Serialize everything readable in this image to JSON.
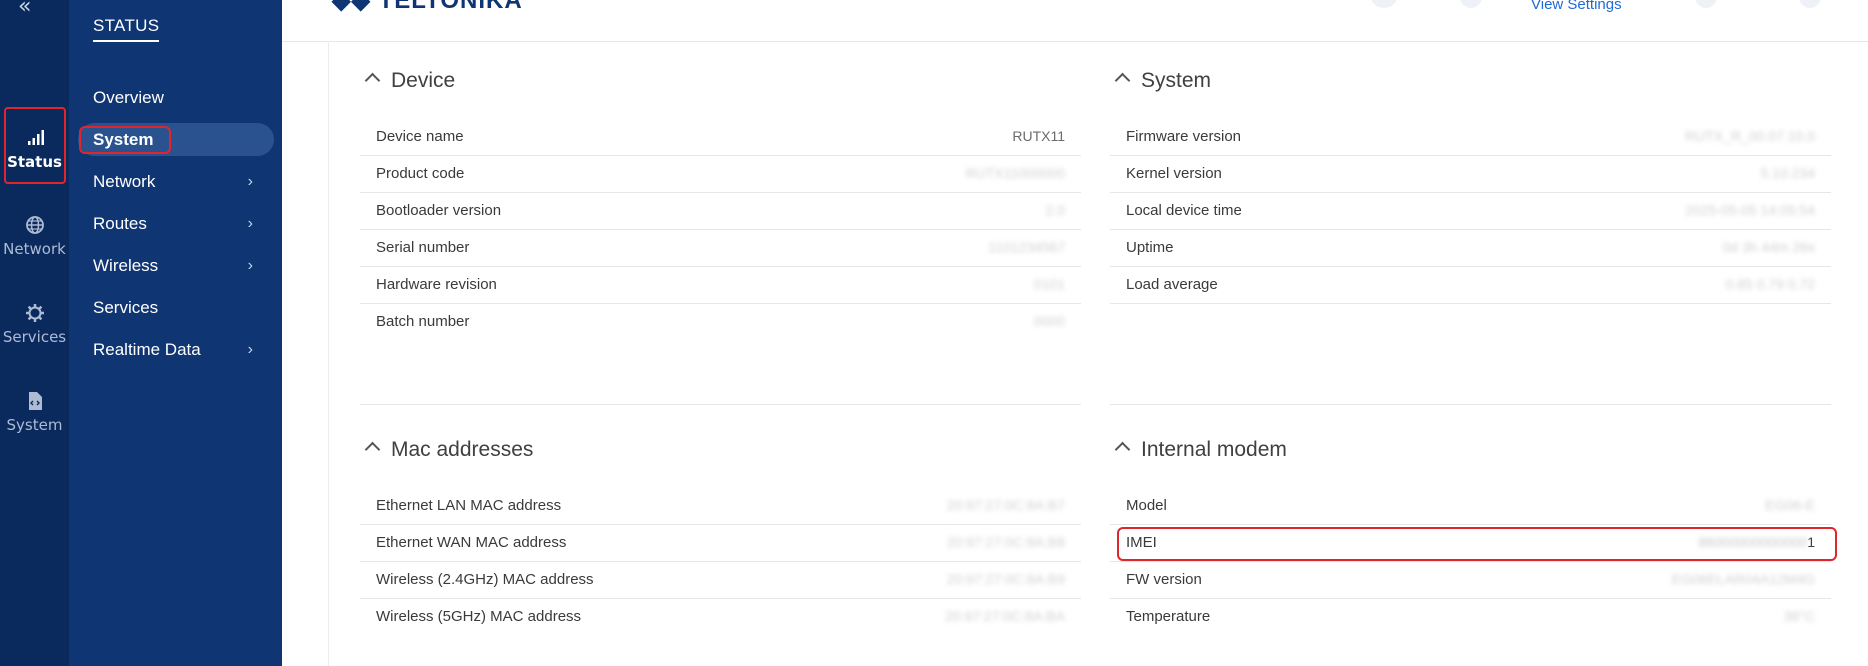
{
  "rail": {
    "collapse_icon": "double-chevron-left-icon",
    "items": [
      {
        "label": "Status",
        "icon": "signal-bars-icon",
        "active": true
      },
      {
        "label": "Network",
        "icon": "globe-icon",
        "active": false
      },
      {
        "label": "Services",
        "icon": "gear-icon",
        "active": false
      },
      {
        "label": "System",
        "icon": "file-code-icon",
        "active": false
      }
    ]
  },
  "sidebar": {
    "title": "STATUS",
    "items": [
      {
        "label": "Overview",
        "has_submenu": false
      },
      {
        "label": "System",
        "has_submenu": false,
        "active": true
      },
      {
        "label": "Network",
        "has_submenu": true
      },
      {
        "label": "Routes",
        "has_submenu": true
      },
      {
        "label": "Wireless",
        "has_submenu": true
      },
      {
        "label": "Services",
        "has_submenu": false
      },
      {
        "label": "Realtime Data",
        "has_submenu": true
      }
    ]
  },
  "header": {
    "logo_text": "TELTONIKA",
    "view_settings_label": "View Settings"
  },
  "device": {
    "title": "Device",
    "rows": [
      {
        "label": "Device name",
        "value": "RUTX11"
      },
      {
        "label": "Product code",
        "value": "RUTX11000000"
      },
      {
        "label": "Bootloader version",
        "value": "2.0"
      },
      {
        "label": "Serial number",
        "value": "1101234567"
      },
      {
        "label": "Hardware revision",
        "value": "0101"
      },
      {
        "label": "Batch number",
        "value": "0000"
      }
    ]
  },
  "system": {
    "title": "System",
    "rows": [
      {
        "label": "Firmware version",
        "value": "RUTX_R_00.07.10.0"
      },
      {
        "label": "Kernel version",
        "value": "5.10.234"
      },
      {
        "label": "Local device time",
        "value": "2025-05-05 14:05:54"
      },
      {
        "label": "Uptime",
        "value": "0d 3h 44m 26s"
      },
      {
        "label": "Load average",
        "value": "0.85 0.79 0.72"
      }
    ]
  },
  "mac": {
    "title": "Mac addresses",
    "rows": [
      {
        "label": "Ethernet LAN MAC address",
        "value": "20:97:27:0C:8A:B7"
      },
      {
        "label": "Ethernet WAN MAC address",
        "value": "20:97:27:0C:8A:B8"
      },
      {
        "label": "Wireless (2.4GHz) MAC address",
        "value": "20:97:27:0C:8A:B9"
      },
      {
        "label": "Wireless (5GHz) MAC address",
        "value": "20:97:27:0C:8A:BA"
      }
    ]
  },
  "modem": {
    "title": "Internal modem",
    "rows": [
      {
        "label": "Model",
        "value": "EG06-E"
      },
      {
        "label": "IMEI",
        "value": "86000000000000",
        "value_suffix": "1"
      },
      {
        "label": "FW version",
        "value": "EG06ELAR04A12M4G"
      },
      {
        "label": "Temperature",
        "value": "38°C"
      }
    ]
  },
  "colors": {
    "rail_bg": "#0a2a5e",
    "sidebar_bg": "#0f3573",
    "sidebar_active": "#2a528f",
    "highlight": "#e0252c",
    "link": "#1e6bd6"
  }
}
